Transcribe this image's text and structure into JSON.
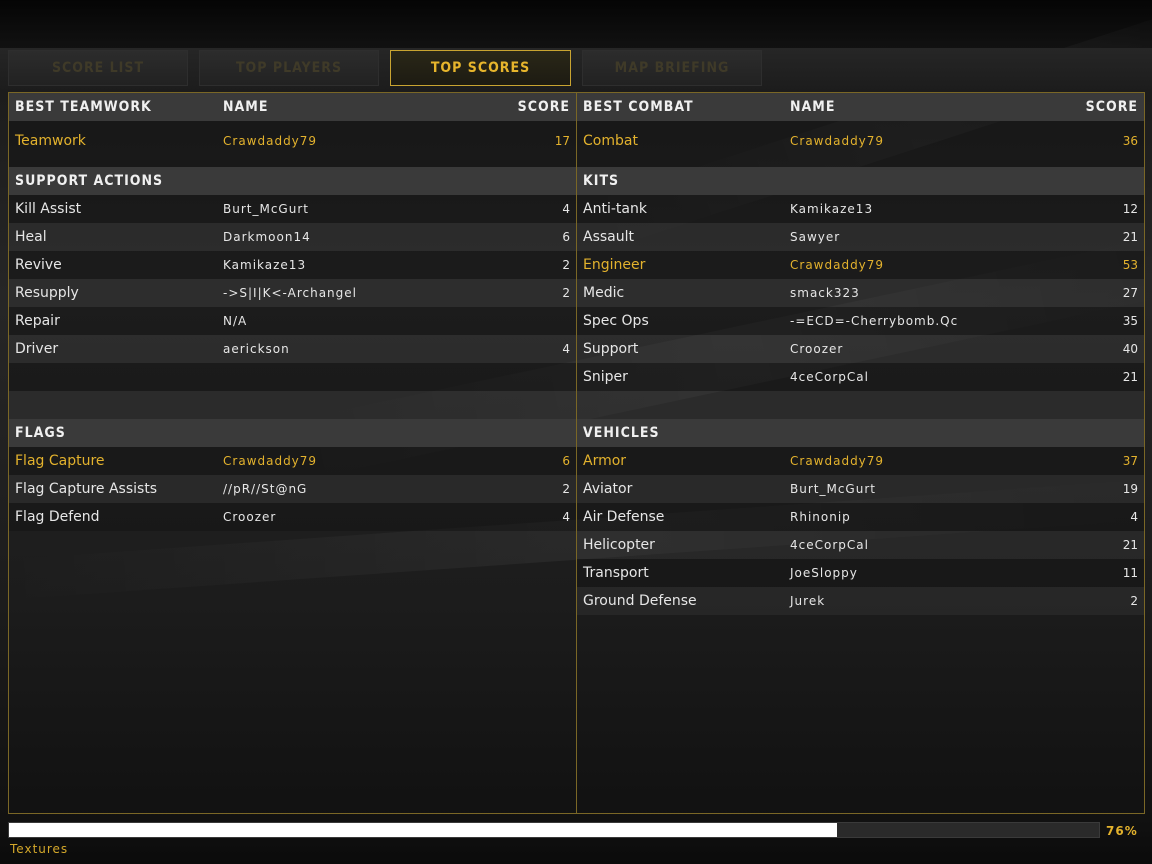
{
  "tabs": [
    {
      "label": "SCORE LIST",
      "active": false
    },
    {
      "label": "TOP PLAYERS",
      "active": false
    },
    {
      "label": "TOP SCORES",
      "active": true
    },
    {
      "label": "MAP BRIEFING",
      "active": false
    }
  ],
  "left": {
    "header": {
      "category": "BEST TEAMWORK",
      "name": "NAME",
      "score": "SCORE"
    },
    "best": {
      "category": "Teamwork",
      "name": "Crawdaddy79",
      "score": "17"
    },
    "support_title": "SUPPORT ACTIONS",
    "support": [
      {
        "category": "Kill Assist",
        "name": "Burt_McGurt",
        "score": "4"
      },
      {
        "category": "Heal",
        "name": "Darkmoon14",
        "score": "6"
      },
      {
        "category": "Revive",
        "name": "Kamikaze13",
        "score": "2"
      },
      {
        "category": "Resupply",
        "name": "->S|I|K<-Archangel",
        "score": "2"
      },
      {
        "category": "Repair",
        "name": "N/A",
        "score": ""
      },
      {
        "category": "Driver",
        "name": "aerickson",
        "score": "4"
      }
    ],
    "flags_title": "FLAGS",
    "flags": [
      {
        "category": "Flag Capture",
        "name": "Crawdaddy79",
        "score": "6"
      },
      {
        "category": "Flag Capture Assists",
        "name": "//pR//St@nG",
        "score": "2"
      },
      {
        "category": "Flag Defend",
        "name": "Croozer",
        "score": "4"
      }
    ]
  },
  "right": {
    "header": {
      "category": "BEST COMBAT",
      "name": "NAME",
      "score": "SCORE"
    },
    "best": {
      "category": "Combat",
      "name": "Crawdaddy79",
      "score": "36"
    },
    "kits_title": "KITS",
    "kits": [
      {
        "category": "Anti-tank",
        "name": "Kamikaze13",
        "score": "12"
      },
      {
        "category": "Assault",
        "name": "Sawyer",
        "score": "21"
      },
      {
        "category": "Engineer",
        "name": "Crawdaddy79",
        "score": "53"
      },
      {
        "category": "Medic",
        "name": "smack323",
        "score": "27"
      },
      {
        "category": "Spec Ops",
        "name": "-=ECD=-Cherrybomb.Qc",
        "score": "35"
      },
      {
        "category": "Support",
        "name": "Croozer",
        "score": "40"
      },
      {
        "category": "Sniper",
        "name": "4ceCorpCal",
        "score": "21"
      }
    ],
    "vehicles_title": "VEHICLES",
    "vehicles": [
      {
        "category": "Armor",
        "name": "Crawdaddy79",
        "score": "37"
      },
      {
        "category": "Aviator",
        "name": "Burt_McGurt",
        "score": "19"
      },
      {
        "category": "Air Defense",
        "name": "Rhinonip",
        "score": "4"
      },
      {
        "category": "Helicopter",
        "name": "4ceCorpCal",
        "score": "21"
      },
      {
        "category": "Transport",
        "name": "JoeSloppy",
        "score": "11"
      },
      {
        "category": "Ground Defense",
        "name": "Jurek",
        "score": "2"
      }
    ]
  },
  "loading": {
    "label": "Textures",
    "percent_text": "76%",
    "progress": 0.76
  },
  "colors": {
    "accent": "#e3b22d",
    "border": "#7a6726",
    "inactive_tab_text": "#3f3a28"
  }
}
